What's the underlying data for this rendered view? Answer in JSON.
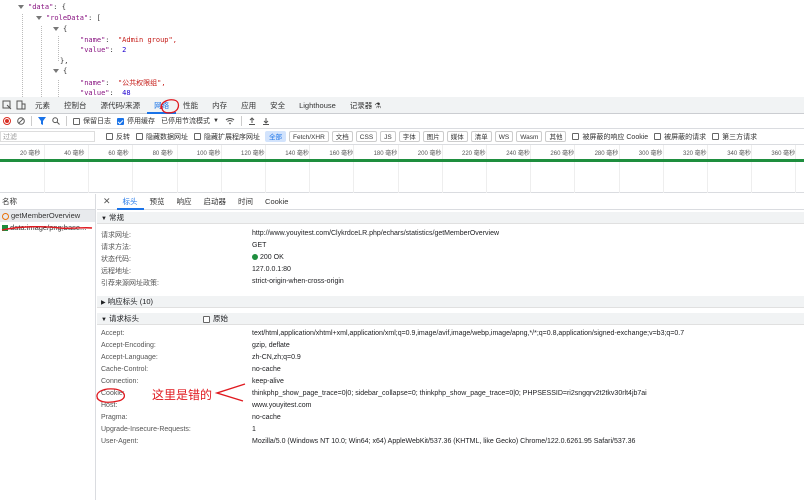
{
  "json_preview": {
    "lines": [
      {
        "key": "\"data\"",
        "sep": ": {",
        "val": "",
        "type": "open"
      },
      {
        "key": "\"roleData\"",
        "sep": ": [",
        "val": "",
        "type": "open"
      },
      {
        "key": "",
        "sep": "{",
        "val": "",
        "type": "brace"
      },
      {
        "key": "\"name\"",
        "sep": ":  ",
        "val": "\"Admin group\",",
        "type": "str"
      },
      {
        "key": "\"value\"",
        "sep": ":  ",
        "val": "2",
        "type": "num"
      },
      {
        "key": "",
        "sep": "},",
        "val": "",
        "type": "brace"
      },
      {
        "key": "",
        "sep": "{",
        "val": "",
        "type": "brace"
      },
      {
        "key": "\"name\"",
        "sep": ":  ",
        "val": "\"公共权限组\",",
        "type": "str"
      },
      {
        "key": "\"value\"",
        "sep": ":  ",
        "val": "48",
        "type": "num"
      }
    ]
  },
  "devtools_tabs": [
    "元素",
    "控制台",
    "源代码/来源",
    "网络",
    "性能",
    "内存",
    "应用",
    "安全",
    "Lighthouse",
    "记录器 ⚗"
  ],
  "active_devtools_tab": "网络",
  "toolbar1": {
    "preserve_log": "保留日志",
    "disable_cache": "停用缓存",
    "throttle": "已停用节流模式"
  },
  "toolbar2": {
    "filter_placeholder": "过滤",
    "invert": "反转",
    "hide_data_urls": "隐藏数据网址",
    "hide_extension_urls": "隐藏扩展程序网址",
    "types": [
      "全部",
      "Fetch/XHR",
      "文档",
      "CSS",
      "JS",
      "字体",
      "图片",
      "媒体",
      "清单",
      "WS",
      "Wasm",
      "其他"
    ],
    "blocked_response_cookies": "被屏蔽的响应 Cookie",
    "blocked_requests": "被屏蔽的请求",
    "third_party": "第三方请求"
  },
  "timeline_ticks": [
    "20 毫秒",
    "40 毫秒",
    "60 毫秒",
    "80 毫秒",
    "100 毫秒",
    "120 毫秒",
    "140 毫秒",
    "160 毫秒",
    "180 毫秒",
    "200 毫秒",
    "220 毫秒",
    "240 毫秒",
    "260 毫秒",
    "280 毫秒",
    "300 毫秒",
    "320 毫秒",
    "340 毫秒",
    "360 毫秒"
  ],
  "request_list": {
    "header": "名称",
    "items": [
      "getMemberOverview",
      "data:image/png;base..."
    ]
  },
  "detail_tabs": [
    "标头",
    "预览",
    "响应",
    "启动器",
    "时间",
    "Cookie"
  ],
  "active_detail_tab": "标头",
  "general": {
    "title": "常规",
    "rows": [
      {
        "k": "请求网址:",
        "v": "http://www.youyitest.com/ClykrdceLR.php/echars/statistics/getMemberOverview"
      },
      {
        "k": "请求方法:",
        "v": "GET"
      },
      {
        "k": "状态代码:",
        "v": "200 OK"
      },
      {
        "k": "远程地址:",
        "v": "127.0.0.1:80"
      },
      {
        "k": "引荐来源网址政策:",
        "v": "strict-origin-when-cross-origin"
      }
    ]
  },
  "response_headers": {
    "title": "响应标头 (10)"
  },
  "request_headers": {
    "title": "请求标头",
    "raw_label": "原始",
    "rows": [
      {
        "k": "Accept:",
        "v": "text/html,application/xhtml+xml,application/xml;q=0.9,image/avif,image/webp,image/apng,*/*;q=0.8,application/signed-exchange;v=b3;q=0.7"
      },
      {
        "k": "Accept-Encoding:",
        "v": "gzip, deflate"
      },
      {
        "k": "Accept-Language:",
        "v": "zh-CN,zh;q=0.9"
      },
      {
        "k": "Cache-Control:",
        "v": "no-cache"
      },
      {
        "k": "Connection:",
        "v": "keep-alive"
      },
      {
        "k": "Cookie:",
        "v": "thinkphp_show_page_trace=0|0; sidebar_collapse=0; thinkphp_show_page_trace=0|0; PHPSESSID=ri2sngqrv2t2tkv30rlt4jb7ai"
      },
      {
        "k": "Host:",
        "v": "www.youyitest.com"
      },
      {
        "k": "Pragma:",
        "v": "no-cache"
      },
      {
        "k": "Upgrade-Insecure-Requests:",
        "v": "1"
      },
      {
        "k": "User-Agent:",
        "v": "Mozilla/5.0 (Windows NT 10.0; Win64; x64) AppleWebKit/537.36 (KHTML, like Gecko) Chrome/122.0.6261.95 Safari/537.36"
      }
    ]
  },
  "annotation": {
    "text": "这里是错的",
    "color": "#e0191f"
  }
}
